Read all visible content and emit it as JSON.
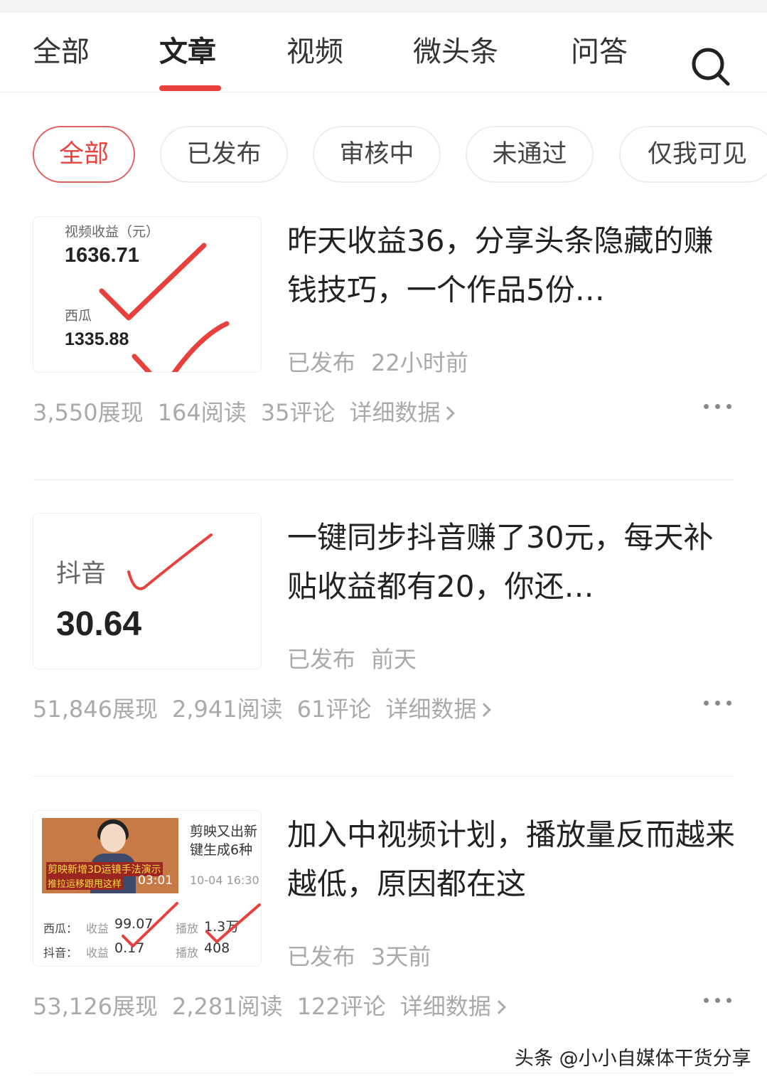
{
  "tabs": [
    "全部",
    "文章",
    "视频",
    "微头条",
    "问答"
  ],
  "active_tab": "文章",
  "filters": [
    "全部",
    "已发布",
    "审核中",
    "未通过",
    "仅我可见"
  ],
  "active_filter": "全部",
  "icons": {
    "search": "search-icon",
    "more": "more-icon",
    "chevron": "chevron-right-icon"
  },
  "colors": {
    "accent": "#e8413d",
    "check_mark": "#e8413d",
    "muted_text": "#a9a9a9"
  },
  "articles": [
    {
      "title": "昨天收益36，分享头条隐藏的赚钱技巧，一个作品5份…",
      "status": "已发布",
      "time": "22小时前",
      "stats": {
        "impressions": "3,550展现",
        "reads": "164阅读",
        "comments": "35评论",
        "detail": "详细数据"
      },
      "thumb": {
        "label1": "视频收益（元）",
        "value1": "1636.71",
        "label2": "西瓜",
        "value2": "1335.88"
      }
    },
    {
      "title": "一键同步抖音赚了30元，每天补贴收益都有20，你还…",
      "status": "已发布",
      "time": "前天",
      "stats": {
        "impressions": "51,846展现",
        "reads": "2,941阅读",
        "comments": "61评论",
        "detail": "详细数据"
      },
      "thumb": {
        "label1": "抖音",
        "value1": "30.64"
      }
    },
    {
      "title": "加入中视频计划，播放量反而越来越低，原因都在这",
      "status": "已发布",
      "time": "3天前",
      "stats": {
        "impressions": "53,126展现",
        "reads": "2,281阅读",
        "comments": "122评论",
        "detail": "详细数据"
      },
      "thumb": {
        "video_title": "剪映又出新键生成6种",
        "video_date": "10-04 16:30",
        "video_caption1": "剪映新增3D运镜手法演示",
        "video_caption2": "推拉运移跟甩这样",
        "video_duration": "03:01",
        "row1_platform": "西瓜：",
        "row1_income_label": "收益",
        "row1_income": "99.07",
        "row1_play_label": "播放",
        "row1_play": "1.3万",
        "row2_platform": "抖音：",
        "row2_income_label": "收益",
        "row2_income": "0.17",
        "row2_play_label": "播放",
        "row2_play": "408"
      }
    }
  ],
  "watermark": "头条 @小小自媒体干货分享"
}
